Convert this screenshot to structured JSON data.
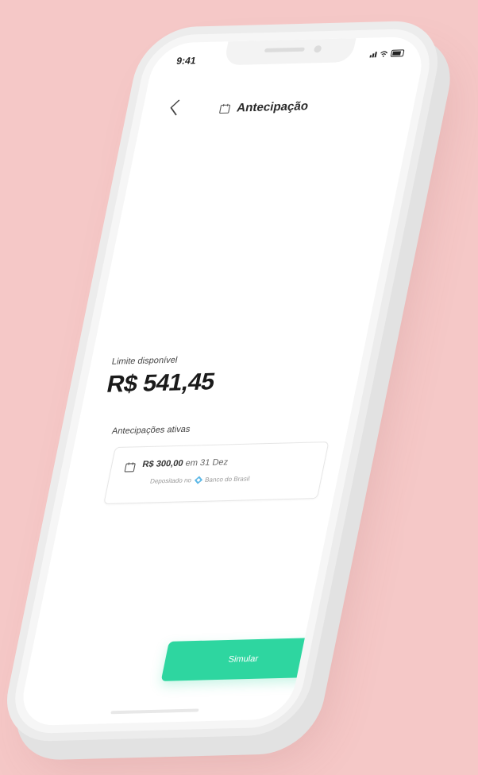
{
  "status_bar": {
    "time": "9:41"
  },
  "header": {
    "back_icon": "chevron-left-icon",
    "title_icon": "calendar-icon",
    "title": "Antecipação"
  },
  "balance": {
    "label": "Limite disponível",
    "value": "R$ 541,45"
  },
  "active_advances": {
    "label": "Antecipações ativas",
    "items": [
      {
        "icon": "calendar-icon",
        "amount": "R$ 300,00",
        "date_text": "em 31 Dez",
        "deposit_prefix": "Depositado no",
        "bank_icon": "banco-do-brasil-logo-icon",
        "bank_name": "Banco do Brasil"
      }
    ]
  },
  "actions": {
    "simulate_label": "Simular"
  },
  "colors": {
    "background": "#f5c8c7",
    "accent": "#2ed6a0",
    "phone_frame": "#f6f6f6",
    "bank_logo": "#5bb7e6"
  }
}
